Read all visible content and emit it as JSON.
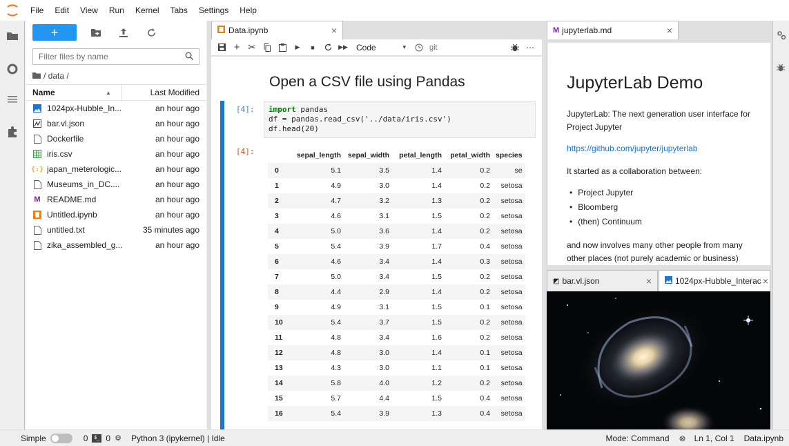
{
  "menu": [
    "File",
    "Edit",
    "View",
    "Run",
    "Kernel",
    "Tabs",
    "Settings",
    "Help"
  ],
  "filebrowser": {
    "new_label": "+",
    "filter_placeholder": "Filter files by name",
    "breadcrumb": "/ data /",
    "col_name": "Name",
    "col_modified": "Last Modified",
    "files": [
      {
        "name": "1024px-Hubble_In...",
        "modified": "an hour ago",
        "icon": "image-icon",
        "color": "#1976d2"
      },
      {
        "name": "bar.vl.json",
        "modified": "an hour ago",
        "icon": "vega-icon",
        "color": "#424242"
      },
      {
        "name": "Dockerfile",
        "modified": "an hour ago",
        "icon": "file-icon",
        "color": "#616161"
      },
      {
        "name": "iris.csv",
        "modified": "an hour ago",
        "icon": "spreadsheet-icon",
        "color": "#43a047"
      },
      {
        "name": "japan_meterologic...",
        "modified": "an hour ago",
        "icon": "json-icon",
        "color": "#f9a825"
      },
      {
        "name": "Museums_in_DC....",
        "modified": "an hour ago",
        "icon": "file-icon",
        "color": "#616161"
      },
      {
        "name": "README.md",
        "modified": "an hour ago",
        "icon": "markdown-icon",
        "color": "#7b1fa2"
      },
      {
        "name": "Untitled.ipynb",
        "modified": "an hour ago",
        "icon": "notebook-icon",
        "color": "#f57c00"
      },
      {
        "name": "untitled.txt",
        "modified": "35 minutes ago",
        "icon": "file-icon",
        "color": "#616161"
      },
      {
        "name": "zika_assembled_g...",
        "modified": "an hour ago",
        "icon": "file-icon",
        "color": "#616161"
      }
    ]
  },
  "notebook": {
    "tab_title": "Data.ipynb",
    "cell_type": "Code",
    "git_label": "git",
    "heading": "Open a CSV file using Pandas",
    "in_prompt": "[4]:",
    "out_prompt": "[4]:",
    "code_lines": [
      {
        "kw": "import",
        "rest": " pandas"
      },
      {
        "kw": "",
        "rest": "df = pandas.read_csv('../data/iris.csv')"
      },
      {
        "kw": "",
        "rest": "df.head(20)"
      }
    ],
    "table": {
      "columns": [
        "",
        "sepal_length",
        "sepal_width",
        "petal_length",
        "petal_width",
        "species"
      ],
      "rows": [
        [
          "0",
          "5.1",
          "3.5",
          "1.4",
          "0.2",
          "se"
        ],
        [
          "1",
          "4.9",
          "3.0",
          "1.4",
          "0.2",
          "setosa"
        ],
        [
          "2",
          "4.7",
          "3.2",
          "1.3",
          "0.2",
          "setosa"
        ],
        [
          "3",
          "4.6",
          "3.1",
          "1.5",
          "0.2",
          "setosa"
        ],
        [
          "4",
          "5.0",
          "3.6",
          "1.4",
          "0.2",
          "setosa"
        ],
        [
          "5",
          "5.4",
          "3.9",
          "1.7",
          "0.4",
          "setosa"
        ],
        [
          "6",
          "4.6",
          "3.4",
          "1.4",
          "0.3",
          "setosa"
        ],
        [
          "7",
          "5.0",
          "3.4",
          "1.5",
          "0.2",
          "setosa"
        ],
        [
          "8",
          "4.4",
          "2.9",
          "1.4",
          "0.2",
          "setosa"
        ],
        [
          "9",
          "4.9",
          "3.1",
          "1.5",
          "0.1",
          "setosa"
        ],
        [
          "10",
          "5.4",
          "3.7",
          "1.5",
          "0.2",
          "setosa"
        ],
        [
          "11",
          "4.8",
          "3.4",
          "1.6",
          "0.2",
          "setosa"
        ],
        [
          "12",
          "4.8",
          "3.0",
          "1.4",
          "0.1",
          "setosa"
        ],
        [
          "13",
          "4.3",
          "3.0",
          "1.1",
          "0.1",
          "setosa"
        ],
        [
          "14",
          "5.8",
          "4.0",
          "1.2",
          "0.2",
          "setosa"
        ],
        [
          "15",
          "5.7",
          "4.4",
          "1.5",
          "0.4",
          "setosa"
        ],
        [
          "16",
          "5.4",
          "3.9",
          "1.3",
          "0.4",
          "setosa"
        ]
      ]
    }
  },
  "markdown": {
    "tab_title": "jupyterlab.md",
    "heading": "JupyterLab Demo",
    "p1": "JupyterLab: The next generation user interface for Project Jupyter",
    "link": "https://github.com/jupyter/jupyterlab",
    "p2": "It started as a collaboration between:",
    "bullets": [
      "Project Jupyter",
      "Bloomberg",
      "(then) Continuum"
    ],
    "p3": "and now involves many other people from many other places (not purely academic or business)"
  },
  "lower_tabs": {
    "tab1": "bar.vl.json",
    "tab2": "1024px-Hubble_Interac"
  },
  "status": {
    "mode_label": "Simple",
    "terminals": "0",
    "kernels": "0",
    "kernel": "Python 3 (ipykernel) | Idle",
    "mode": "Mode: Command",
    "position": "Ln 1, Col 1",
    "file": "Data.ipynb"
  },
  "colors": {
    "accent": "#2196f3",
    "prompt": "#d84315",
    "keyword": "#008000",
    "link": "#1976d2"
  }
}
